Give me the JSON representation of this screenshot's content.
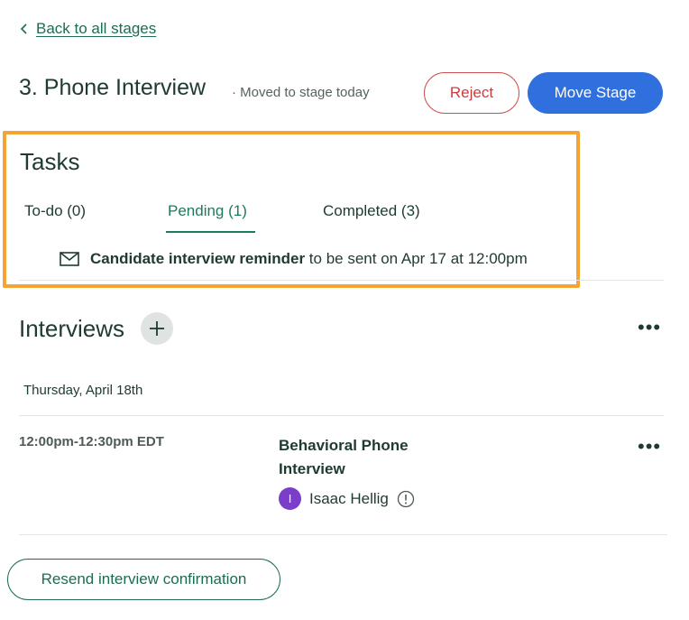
{
  "nav": {
    "back_label": "Back to all stages"
  },
  "stage": {
    "title": "3. Phone Interview",
    "meta": "· Moved to stage today",
    "reject_label": "Reject",
    "move_label": "Move Stage"
  },
  "tasks": {
    "heading": "Tasks",
    "tabs": [
      {
        "label": "To-do (0)"
      },
      {
        "label": "Pending (1)",
        "active": true
      },
      {
        "label": "Completed (3)"
      }
    ],
    "items": [
      {
        "icon": "mail-icon",
        "bold": "Candidate interview reminder",
        "rest": " to be sent on Apr 17 at 12:00pm"
      }
    ]
  },
  "interviews": {
    "heading": "Interviews",
    "more_label": "•••",
    "date": "Thursday, April 18th",
    "items": [
      {
        "time": "12:00pm-12:30pm EDT",
        "title": "Behavioral Phone Interview",
        "interviewer": {
          "initial": "I",
          "name": "Isaac Hellig"
        },
        "more_label": "•••"
      }
    ]
  },
  "footer": {
    "resend_label": "Resend interview confirmation"
  },
  "colors": {
    "accent_green": "#1d6b55",
    "move_blue": "#2f6fde",
    "reject_red": "#cc3b3b",
    "highlight_orange": "#f5a334",
    "avatar_purple": "#7a3ec9"
  }
}
